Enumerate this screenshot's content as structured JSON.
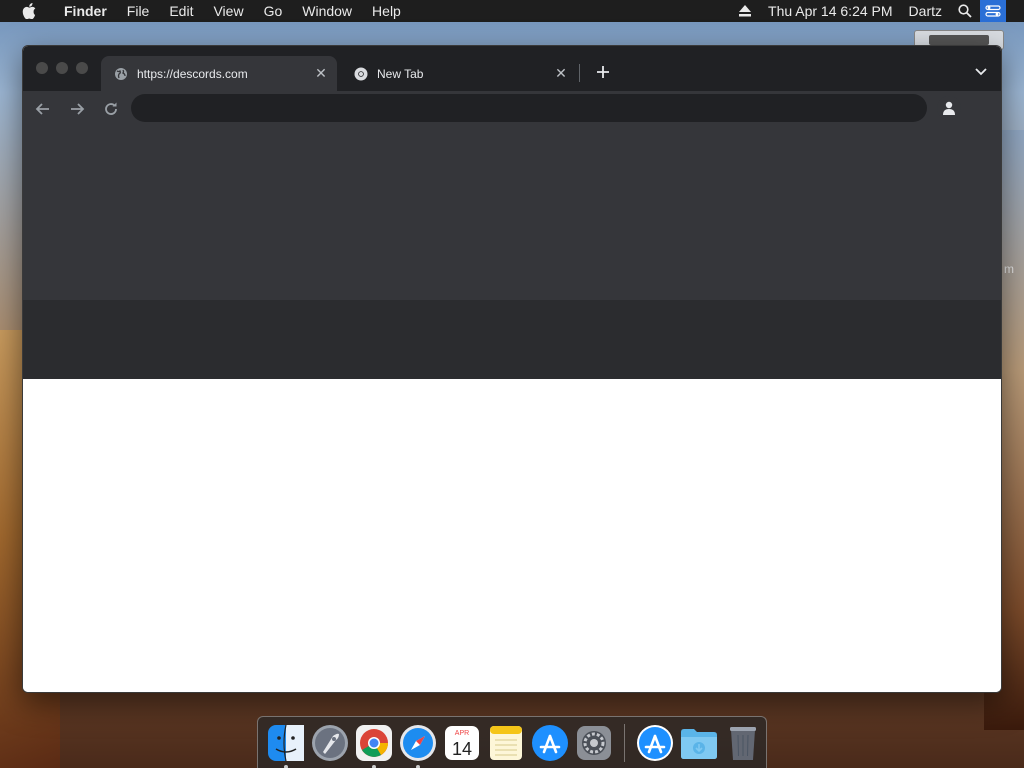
{
  "menubar": {
    "app_name": "Finder",
    "menus": [
      "File",
      "Edit",
      "View",
      "Go",
      "Window",
      "Help"
    ],
    "clock": "Thu Apr 14  6:24 PM",
    "user": "Dartz"
  },
  "desktop": {
    "partial_text": "m"
  },
  "browser": {
    "tabs": [
      {
        "title": "https://descords.com",
        "active": true,
        "favicon": "globe-icon"
      },
      {
        "title": "New Tab",
        "active": false,
        "favicon": "chrome-icon"
      }
    ],
    "address_value": "",
    "address_placeholder": ""
  },
  "dock": {
    "apps": [
      {
        "name": "Finder",
        "icon": "finder-icon",
        "running": true
      },
      {
        "name": "Launchpad",
        "icon": "launchpad-icon",
        "running": false
      },
      {
        "name": "Google Chrome",
        "icon": "chrome-icon",
        "running": true
      },
      {
        "name": "Safari",
        "icon": "safari-icon",
        "running": true
      },
      {
        "name": "Calendar",
        "icon": "calendar-icon",
        "running": false,
        "month": "APR",
        "day": "14"
      },
      {
        "name": "Notes",
        "icon": "notes-icon",
        "running": false
      },
      {
        "name": "App Store",
        "icon": "app-store-icon",
        "running": false
      },
      {
        "name": "System Preferences",
        "icon": "system-preferences-icon",
        "running": false
      },
      {
        "name": "App Store",
        "icon": "app-store-icon",
        "running": false
      },
      {
        "name": "Downloads",
        "icon": "downloads-folder-icon",
        "running": false
      },
      {
        "name": "Trash",
        "icon": "trash-icon",
        "running": false
      }
    ]
  },
  "colors": {
    "accent": "#2a6fd6",
    "tabstrip": "#202124",
    "toolbar": "#35363a"
  }
}
